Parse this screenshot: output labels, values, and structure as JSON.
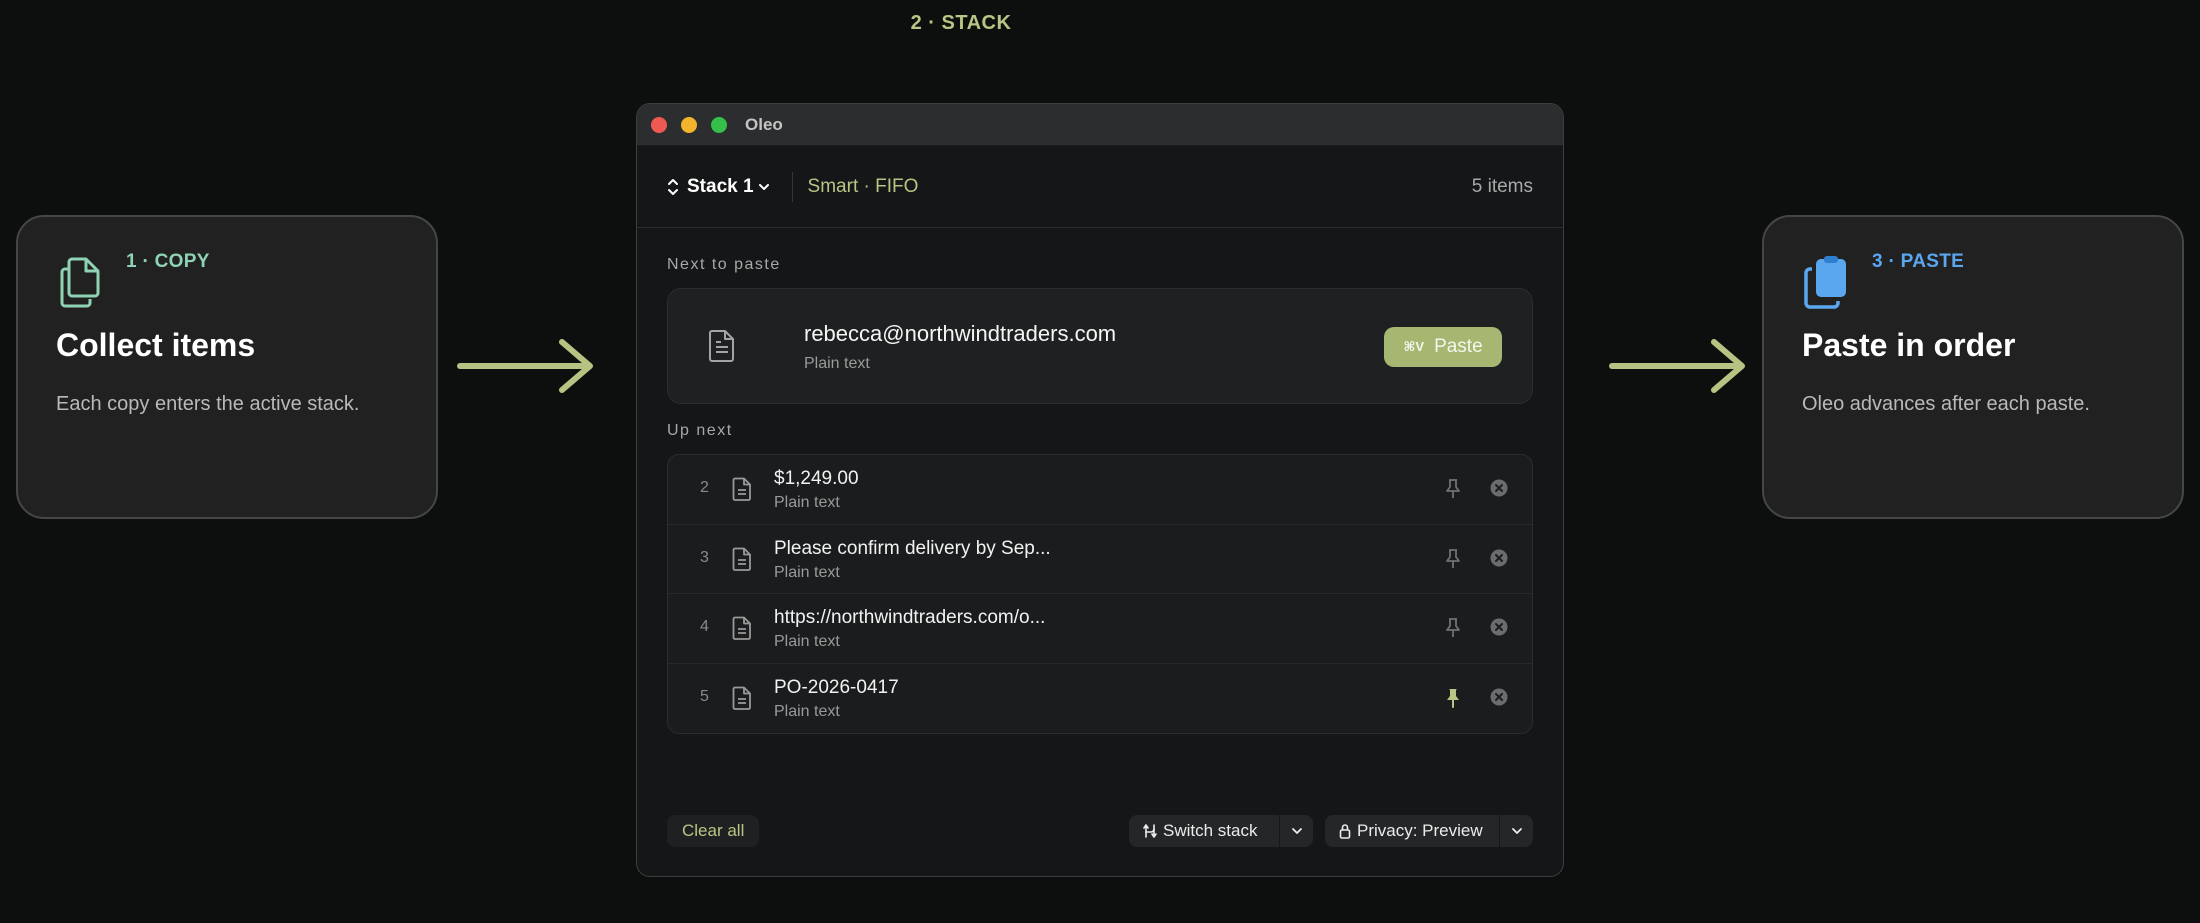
{
  "stage": {
    "label": "2 · STACK",
    "color": "#b7c684"
  },
  "copy_card": {
    "step": "1 · COPY",
    "title": "Collect items",
    "description": "Each copy enters the active stack.",
    "accent": "#8fd3b4",
    "icon": "copy-icon"
  },
  "paste_card": {
    "step": "3 · PASTE",
    "title": "Paste in order",
    "description": "Oleo advances after each paste.",
    "accent": "#5aa7ef",
    "icon": "clipboard-icon"
  },
  "window": {
    "title": "Oleo",
    "toolbar": {
      "stack_name": "Stack 1",
      "mode": "Smart · FIFO",
      "item_count": "5 items"
    },
    "next_label": "Next to paste",
    "next_item": {
      "value": "rebecca@northwindtraders.com",
      "kind": "Plain text",
      "paste_shortcut": "⌘V",
      "paste_label": "Paste"
    },
    "up_next_label": "Up next",
    "queue": [
      {
        "index": "2",
        "value": "$1,249.00",
        "kind": "Plain text",
        "pinned": false
      },
      {
        "index": "3",
        "value": "Please confirm delivery by Sep...",
        "kind": "Plain text",
        "pinned": false
      },
      {
        "index": "4",
        "value": "https://northwindtraders.com/o...",
        "kind": "Plain text",
        "pinned": false
      },
      {
        "index": "5",
        "value": "PO-2026-0417",
        "kind": "Plain text",
        "pinned": true
      }
    ],
    "footer": {
      "clear_label": "Clear all",
      "switch_label": "Switch stack",
      "privacy_label": "Privacy: Preview"
    }
  },
  "colors": {
    "accent_green": "#a5b771",
    "background": "#0d0e0e",
    "arrow": "#b5c483"
  }
}
